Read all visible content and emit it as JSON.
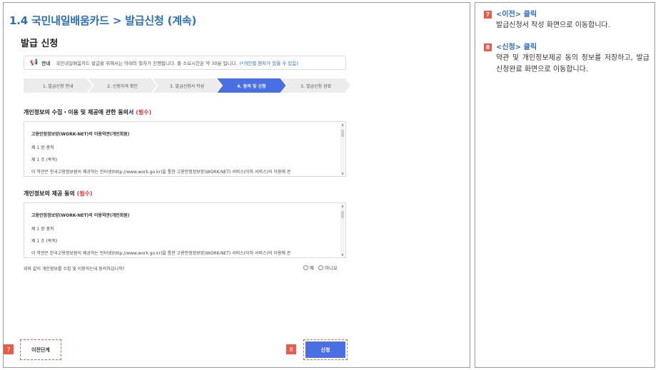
{
  "section_title": "1.4 국민내일배움카드 > 발급신청 (계속)",
  "page_title": "발급 신청",
  "info": {
    "icon": "megaphone-icon",
    "label": "안내",
    "text": "국민내일배움카드 발급을 위해서는 아래의 절차가 진행됩니다. 총 소요시간은 약 30분 입니다.",
    "note": "(*개인별 편차가 있을 수 있음)"
  },
  "steps": [
    {
      "label": "1. 발급신청 안내"
    },
    {
      "label": "2. 신청자격 확인"
    },
    {
      "label": "3. 발급신청서 작성"
    },
    {
      "label": "4. 동의 및 신청"
    },
    {
      "label": "5. 발급신청 완료"
    }
  ],
  "active_step": 4,
  "consent1": {
    "title": "개인정보의 수집・이용 및 제공에 관한 동의서",
    "required": "(필수)",
    "lines": [
      "고용안정정보망(WORK-NET)의 이용약관(개인회원)",
      "제 1 장 총칙",
      "제 1 조 (목적)",
      "이 약관은 한국고용정보원이 제공하는 인터넷(http://www.work.go.kr)을 통한 고용안정정보망(WORK-NET) 서비스(이하 서비스)의 이용에 관"
    ]
  },
  "consent2": {
    "title": "개인정보의 제공 동의",
    "required": "(필수)",
    "lines": [
      "고용안정정보망(WORK-NET)의 이용약관(개인회원)",
      "제 1 장 총칙",
      "제 1 조 (목적)",
      "이 약관은 한국고용정보원이 제공하는 인터넷(http://www.work.go.kr)을 통한 고용안정정보망(WORK-NET) 서비스(이하 서비스)의 이용에 관"
    ]
  },
  "consent_question": "위와 같이 개인정보를 수집 및 이용하는데 동의하십니까?",
  "options": {
    "yes": "예",
    "no": "아니오"
  },
  "buttons": {
    "prev": "이전단계",
    "apply": "신청"
  },
  "markers": {
    "prev": "7",
    "apply": "8"
  },
  "instructions": [
    {
      "num": "7",
      "title": "<이전> 클릭",
      "desc": "발급신청서 작성 화면으로 이동합니다."
    },
    {
      "num": "8",
      "title": "<신청> 클릭",
      "desc": "약관 및 개인정보제공 동의 정보를 저장하고, 발급신청완료 화면으로 이동합니다."
    }
  ],
  "colors": {
    "accent": "#4a6fe3",
    "title": "#2b6fbf",
    "marker": "#ef5a46",
    "required": "#e53935"
  }
}
